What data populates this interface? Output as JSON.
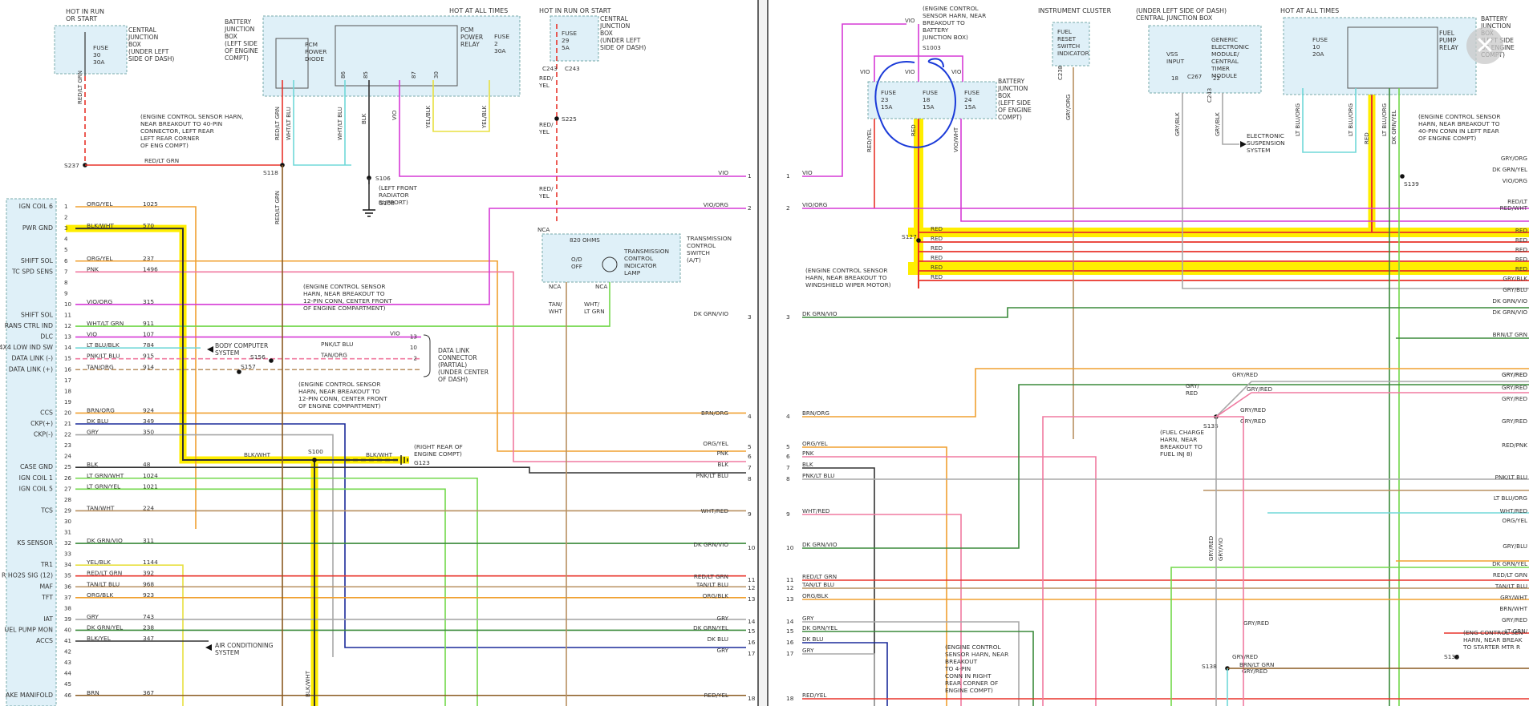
{
  "window": {
    "close_icon": "close-icon",
    "close_glyph": "✕"
  },
  "left": {
    "header": {
      "hot_run_start_1": [
        "HOT IN RUN",
        "OR START"
      ],
      "cjb_1": [
        "CENTRAL",
        "JUNCTION",
        "BOX",
        "(UNDER LEFT",
        "SIDE OF DASH)"
      ],
      "fuse30": [
        "FUSE",
        "30",
        "30A"
      ],
      "batt_jbox": [
        "BATTERY",
        "JUNCTION",
        "BOX",
        "(LEFT SIDE",
        "OF ENGINE",
        "COMPT)"
      ],
      "hot_all_times": "HOT AT ALL TIMES",
      "pcm_diode": [
        "PCM",
        "POWER",
        "DIODE"
      ],
      "pcm_relay": [
        "PCM",
        "POWER",
        "RELAY"
      ],
      "fuse2": [
        "FUSE",
        "2",
        "30A"
      ],
      "hot_run_start_2": "HOT IN RUN OR START",
      "fuse29": [
        "FUSE",
        "29",
        "5A"
      ],
      "cjb_2": [
        "CENTRAL",
        "JUNCTION",
        "BOX",
        "(UNDER LEFT",
        "SIDE OF DASH)"
      ],
      "s237": "S237",
      "s118": "S118",
      "s106": "S106",
      "s225": "S225",
      "c243a": "C243",
      "c243b": "C243",
      "g108": "G108",
      "left_front_rad": [
        "(LEFT FRONT",
        "RADIATOR",
        "SUPPORT)"
      ],
      "ecs_note": [
        "(ENGINE CONTROL SENSOR HARN,",
        "NEAR BREAKOUT TO 40-PIN",
        "CONNECTOR, LEFT REAR",
        "LEFT REAR CORNER",
        "OF ENG COMPT)"
      ]
    },
    "pins": [
      {
        "n": "1",
        "label": "IGN COIL 6",
        "color": "ORG/YEL",
        "circuit": "1025"
      },
      {
        "n": "2",
        "label": "",
        "color": "",
        "circuit": ""
      },
      {
        "n": "3",
        "label": "PWR GND",
        "color": "BLK/WHT",
        "circuit": "570"
      },
      {
        "n": "4",
        "label": "",
        "color": "",
        "circuit": ""
      },
      {
        "n": "5",
        "label": "",
        "color": "",
        "circuit": ""
      },
      {
        "n": "6",
        "label": "SHIFT SOL",
        "color": "ORG/YEL",
        "circuit": "237"
      },
      {
        "n": "7",
        "label": "TC SPD SENS",
        "color": "PNK",
        "circuit": "1496"
      },
      {
        "n": "8",
        "label": "",
        "color": "",
        "circuit": ""
      },
      {
        "n": "9",
        "label": "",
        "color": "",
        "circuit": ""
      },
      {
        "n": "10",
        "label": "",
        "color": "VIO/ORG",
        "circuit": "315"
      },
      {
        "n": "11",
        "label": "SHIFT SOL",
        "color": "",
        "circuit": ""
      },
      {
        "n": "12",
        "label": "RANS CTRL IND",
        "color": "WHT/LT GRN",
        "circuit": "911"
      },
      {
        "n": "13",
        "label": "DLC",
        "color": "VIO",
        "circuit": "107"
      },
      {
        "n": "14",
        "label": "4X4 LOW IND SW",
        "color": "LT BLU/BLK",
        "circuit": "784"
      },
      {
        "n": "15",
        "label": "DATA LINK (-)",
        "color": "PNK/LT BLU",
        "circuit": "915"
      },
      {
        "n": "16",
        "label": "DATA LINK (+)",
        "color": "TAN/ORG",
        "circuit": "914"
      },
      {
        "n": "17",
        "label": "",
        "color": "",
        "circuit": ""
      },
      {
        "n": "18",
        "label": "",
        "color": "",
        "circuit": ""
      },
      {
        "n": "19",
        "label": "",
        "color": "",
        "circuit": ""
      },
      {
        "n": "20",
        "label": "CCS",
        "color": "BRN/ORG",
        "circuit": "924"
      },
      {
        "n": "21",
        "label": "CKP(+)",
        "color": "DK BLU",
        "circuit": "349"
      },
      {
        "n": "22",
        "label": "CKP(-)",
        "color": "GRY",
        "circuit": "350"
      },
      {
        "n": "23",
        "label": "",
        "color": "",
        "circuit": ""
      },
      {
        "n": "24",
        "label": "",
        "color": "",
        "circuit": ""
      },
      {
        "n": "25",
        "label": "CASE GND",
        "color": "BLK",
        "circuit": "48"
      },
      {
        "n": "26",
        "label": "IGN COIL 1",
        "color": "LT GRN/WHT",
        "circuit": "1024"
      },
      {
        "n": "27",
        "label": "IGN COIL 5",
        "color": "LT GRN/YEL",
        "circuit": "1021"
      },
      {
        "n": "28",
        "label": "",
        "color": "",
        "circuit": ""
      },
      {
        "n": "29",
        "label": "TCS",
        "color": "TAN/WHT",
        "circuit": "224"
      },
      {
        "n": "30",
        "label": "",
        "color": "",
        "circuit": ""
      },
      {
        "n": "31",
        "label": "",
        "color": "",
        "circuit": ""
      },
      {
        "n": "32",
        "label": "KS SENSOR",
        "color": "DK GRN/VIO",
        "circuit": "311"
      },
      {
        "n": "33",
        "label": "",
        "color": "",
        "circuit": ""
      },
      {
        "n": "34",
        "label": "TR1",
        "color": "YEL/BLK",
        "circuit": "1144"
      },
      {
        "n": "35",
        "label": "R HO2S SIG (12)",
        "color": "RED/LT GRN",
        "circuit": "392"
      },
      {
        "n": "36",
        "label": "MAF",
        "color": "TAN/LT BLU",
        "circuit": "968"
      },
      {
        "n": "37",
        "label": "TFT",
        "color": "ORG/BLK",
        "circuit": "923"
      },
      {
        "n": "38",
        "label": "",
        "color": "",
        "circuit": ""
      },
      {
        "n": "39",
        "label": "IAT",
        "color": "GRY",
        "circuit": "743"
      },
      {
        "n": "40",
        "label": "UEL PUMP MON",
        "color": "DK GRN/YEL",
        "circuit": "238"
      },
      {
        "n": "41",
        "label": "ACCS",
        "color": "BLK/YEL",
        "circuit": "347"
      },
      {
        "n": "42",
        "label": "",
        "color": "",
        "circuit": ""
      },
      {
        "n": "43",
        "label": "",
        "color": "",
        "circuit": ""
      },
      {
        "n": "44",
        "label": "",
        "color": "",
        "circuit": ""
      },
      {
        "n": "45",
        "label": "",
        "color": "",
        "circuit": ""
      },
      {
        "n": "46",
        "label": "AKE MANIFOLD",
        "color": "BRN",
        "circuit": "367"
      }
    ],
    "mid": {
      "body_computer": [
        "BODY COMPUTER",
        "SYSTEM"
      ],
      "s156": "S156",
      "s157": "S157",
      "s100": "S100",
      "g123": "G123",
      "ecs_12pin_a": [
        "(ENGINE CONTROL SENSOR",
        "HARN, NEAR BREAKOUT TO",
        "12-PIN CONN, CENTER FRONT",
        "OF ENGINE COMPARTMENT)"
      ],
      "ecs_12pin_b": [
        "(ENGINE CONTROL SENSOR",
        "HARN, NEAR BREAKOUT TO",
        "12-PIN CONN, CENTER FRONT",
        "OF ENGINE COMPARTMENT)"
      ],
      "dlc": [
        "DATA LINK",
        "CONNECTOR",
        "(PARTIAL)",
        "(UNDER CENTER",
        "OF DASH)"
      ],
      "dlc_pins": [
        "13",
        "10",
        "2"
      ],
      "dlc_wires": [
        "VIO",
        "PNK/LT BLU",
        "TAN/ORG"
      ],
      "right_rear": [
        "(RIGHT REAR OF",
        "ENGINE COMPT)"
      ],
      "ac": [
        "AIR CONDITIONING",
        "SYSTEM"
      ],
      "blk_wht": "BLK/WHT",
      "tcs_switch": [
        "TRANSMISSION",
        "CONTROL",
        "SWITCH",
        "(A/T)"
      ],
      "tcil": [
        "TRANSMISSION",
        "CONTROL",
        "INDICATOR",
        "LAMP"
      ],
      "ohms": "820 OHMS",
      "od_off": [
        "O/D",
        "OFF"
      ],
      "nca": "NCA",
      "tan_wht": [
        "TAN/",
        "WHT"
      ],
      "wht_ltgrn": [
        "WHT/",
        "LT GRN"
      ],
      "red_yel": [
        "RED/",
        "YEL"
      ],
      "wire_labels": [
        "RED/LT GRN",
        "RED/LT GRN",
        "WHT/LT BLU",
        "WHT/LT BLU",
        "BLK",
        "BLK",
        "VIO",
        "YEL/BLK",
        "YEL/BLK"
      ],
      "pin_nums_relay": [
        "86",
        "85",
        "87",
        "30"
      ]
    },
    "edge": [
      {
        "n": "1",
        "label": "VIO"
      },
      {
        "n": "2",
        "label": "VIO/ORG"
      },
      {
        "n": "3",
        "label": "DK GRN/VIO"
      },
      {
        "n": "4",
        "label": "BRN/ORG"
      },
      {
        "n": "5",
        "label": "ORG/YEL"
      },
      {
        "n": "6",
        "label": "PNK"
      },
      {
        "n": "7",
        "label": "BLK"
      },
      {
        "n": "8",
        "label": "PNK/LT BLU"
      },
      {
        "n": "9",
        "label": "WHT/RED"
      },
      {
        "n": "10",
        "label": "DK GRN/VIO"
      },
      {
        "n": "11",
        "label": "RED/LT GRN"
      },
      {
        "n": "12",
        "label": "TAN/LT BLU"
      },
      {
        "n": "13",
        "label": "ORG/BLK"
      },
      {
        "n": "14",
        "label": "GRY"
      },
      {
        "n": "15",
        "label": "DK GRN/YEL"
      },
      {
        "n": "16",
        "label": "DK BLU"
      },
      {
        "n": "17",
        "label": "GRY"
      },
      {
        "n": "18",
        "label": "RED/YEL"
      }
    ]
  },
  "right": {
    "header": {
      "ecs_s1003": [
        "(ENGINE CONTROL",
        "SENSOR HARN, NEAR",
        "BREAKOUT TO",
        "BATTERY",
        "JUNCTION BOX)"
      ],
      "s1003": "S1003",
      "vio": "VIO",
      "fuses": [
        [
          "FUSE",
          "23",
          "15A"
        ],
        [
          "FUSE",
          "18",
          "15A"
        ],
        [
          "FUSE",
          "24",
          "15A"
        ]
      ],
      "batt_jbox": [
        "BATTERY",
        "JUNCTION",
        "BOX",
        "(LEFT SIDE",
        "OF ENGINE",
        "COMPT)"
      ],
      "instrument_cluster": "INSTRUMENT CLUSTER",
      "fuel_reset": [
        "FUEL",
        "RESET",
        "SWITCH",
        "INDICATOR"
      ],
      "under_dash": [
        "(UNDER LEFT SIDE OF DASH)",
        "CENTRAL JUNCTION BOX"
      ],
      "vss": [
        "VSS",
        "INPUT"
      ],
      "gem": [
        "GENERIC",
        "ELECTRONIC",
        "MODULE/",
        "CENTRAL",
        "TIMER",
        "MODULE"
      ],
      "hot_all_times": "HOT AT ALL TIMES",
      "fuse10": [
        "FUSE",
        "10",
        "20A"
      ],
      "fuel_pump_relay": [
        "FUEL",
        "PUMP",
        "RELAY"
      ],
      "batt_jbox2": [
        "BATTERY",
        "JUNCTION",
        "BOX",
        "(LEFT SIDE",
        "OF ENGINE",
        "COMPT)"
      ],
      "elec_susp": [
        "ELECTRONIC",
        "SUSPENSION",
        "SYSTEM"
      ],
      "ecs_s139": [
        "(ENGINE CONTROL SENSOR",
        "HARN, NEAR BREAKOUT TO",
        "40-PIN CONN IN LEFT REAR",
        "OF ENGINE COMPT)"
      ],
      "s139": "S139",
      "s127": "S127",
      "ecs_s127": [
        "(ENGINE CONTROL SENSOR",
        "HARN, NEAR BREAKOUT TO",
        "WINDSHIELD WIPER MOTOR)"
      ],
      "c267": "C267",
      "c243": "C243",
      "c238": "C238",
      "pin18": "18",
      "pin22": "22",
      "pin21": "21",
      "pin14": "14",
      "wire_labels": [
        "RED/YEL",
        "VIO/WHT",
        "GRY/ORG",
        "GRY/BLK",
        "GRY/BLK",
        "LT BLU/ORG",
        "LT BLU/ORG",
        "LT BLU/ORG",
        "DK GRN/YEL",
        "RED",
        "RED"
      ]
    },
    "pins": [
      {
        "n": "1",
        "label": "VIO"
      },
      {
        "n": "2",
        "label": "VIO/ORG"
      },
      {
        "n": "3",
        "label": "DK GRN/VIO"
      },
      {
        "n": "4",
        "label": "BRN/ORG"
      },
      {
        "n": "5",
        "label": "ORG/YEL"
      },
      {
        "n": "6",
        "label": "PNK"
      },
      {
        "n": "7",
        "label": "BLK"
      },
      {
        "n": "8",
        "label": "PNK/LT BLU"
      },
      {
        "n": "9",
        "label": "WHT/RED"
      },
      {
        "n": "10",
        "label": "DK GRN/VIO"
      },
      {
        "n": "11",
        "label": "RED/LT GRN"
      },
      {
        "n": "12",
        "label": "TAN/LT BLU"
      },
      {
        "n": "13",
        "label": "ORG/BLK"
      },
      {
        "n": "14",
        "label": "GRY"
      },
      {
        "n": "15",
        "label": "DK GRN/YEL"
      },
      {
        "n": "16",
        "label": "DK BLU"
      },
      {
        "n": "17",
        "label": "GRY"
      },
      {
        "n": "18",
        "label": "RED/YEL"
      }
    ],
    "red_labels": [
      "RED",
      "RED",
      "RED",
      "RED",
      "RED",
      "RED"
    ],
    "right_edge": [
      "GRY/ORG",
      "DK GRN/YEL",
      "VIO/ORG",
      "RED/LT",
      "RED/WHT",
      "RED",
      "RED",
      "RED",
      "RED",
      "RED",
      "GRY/BLK",
      "GRY/BLU",
      "DK GRN/VIO",
      "DK GRN/VIO",
      "BRN/LT GRN",
      "GRY/RED",
      "GRY/RED",
      "GRY/RED",
      "GRY/RED",
      "GRY/RED",
      "RED/PNK",
      "PNK/LT BLU",
      "LT BLU/ORG",
      "WHT/RED",
      "ORG/YEL",
      "GRY/BLU",
      "DK GRN/YEL",
      "RED/LT GRN",
      "TAN/LT BLU",
      "GRY/WHT",
      "BRN/WHT",
      "GRY/RED",
      "LT GRN/"
    ],
    "s135": "S135",
    "s135_note": [
      "(FUEL CHARGE",
      "HARN, NEAR",
      "BREAKOUT TO",
      "FUEL INJ 8)"
    ],
    "gry_red": [
      "GRY/RED",
      "GRY/RED",
      "GRY/RED",
      "GRY/RED",
      "GRY/RED",
      "GRY/RED",
      "GRY/RED"
    ],
    "gry_red_v": [
      "GRY/",
      "RED"
    ],
    "s138": "S138",
    "s138_note": [
      "(ENGINE CONTROL",
      "SENSOR HARN, NEAR",
      "BREAKOUT",
      "TO 4-PIN",
      "CONN IN RIGHT",
      "REAR CORNER OF",
      "ENGINE COMPT)"
    ],
    "brn_lt_grn": "BRN/LT GRN",
    "s137": "S137",
    "s137_note": [
      "(ENG CONTROL SEN",
      "HARN, NEAR BREAK",
      "TO STARTER MTR R"
    ],
    "gry_red_vert": [
      "GRY/RED",
      "GRY/VIO"
    ]
  },
  "colors": {
    "highlight": "#ffee00",
    "red": "#e8332a",
    "vio": "#d63ad6",
    "org": "#f0a030",
    "pnk": "#f07aa0",
    "ltgrn": "#72d84a",
    "dkgrn": "#3a8a3a",
    "dkblu": "#1a2a9a",
    "gry": "#a8a8a8",
    "blk": "#333333",
    "tan": "#b89060",
    "ltblu": "#70d8d8",
    "brn": "#8a5a20",
    "yel": "#e8e040",
    "boxfill": "#dff0f8",
    "pen": "#1a3ad8"
  }
}
